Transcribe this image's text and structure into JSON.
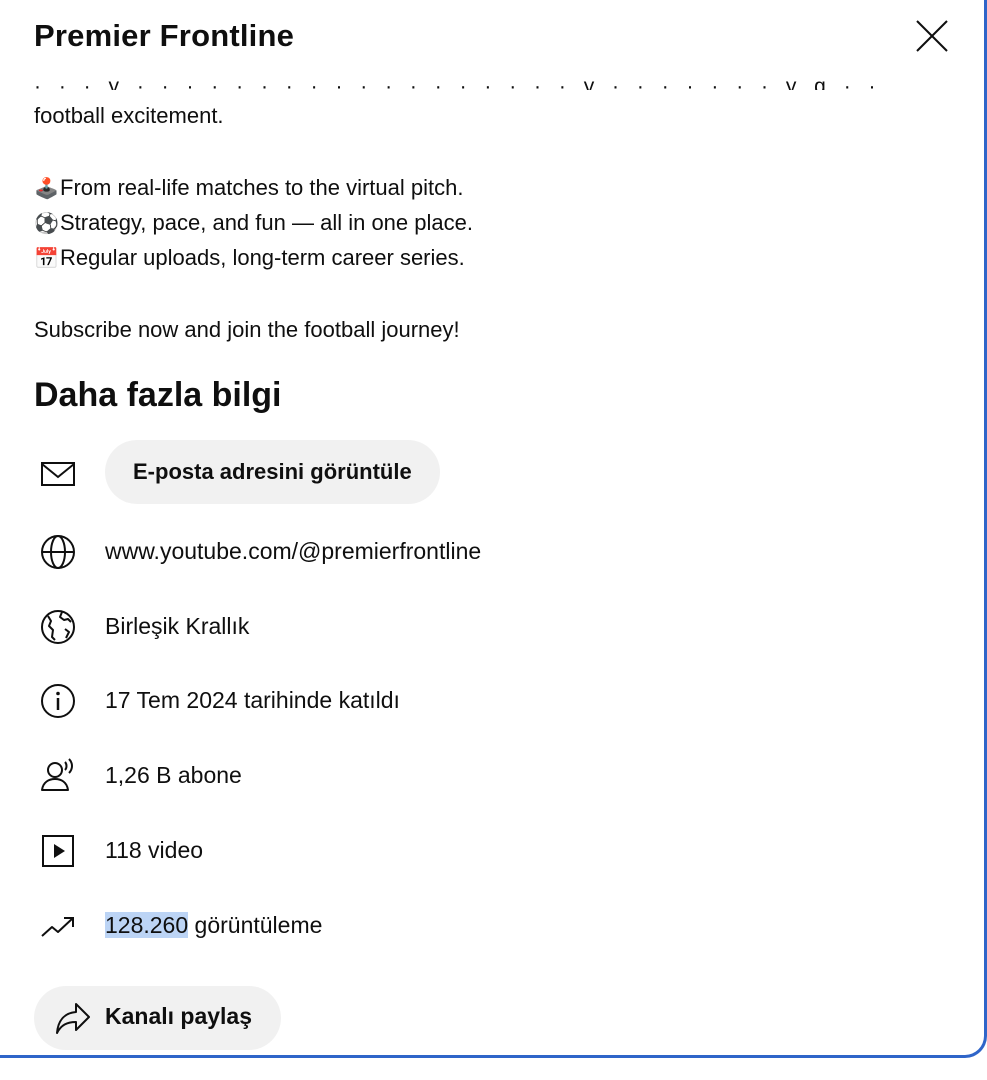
{
  "dialog": {
    "title": "Premier Frontline",
    "close_icon": "close-icon"
  },
  "description": {
    "cutoff_line": "· · · y   ·   · · · ·   · ·   · · · · · · ·   · · · ·   y   ·   · · · · ·   ·   y   g · · ·   ·   · · ·",
    "line_1": "football excitement.",
    "bullets": [
      {
        "emoji": "🕹️",
        "text": "From real-life matches to the virtual pitch."
      },
      {
        "emoji": "⚽",
        "text": "Strategy, pace, and fun — all in one place."
      },
      {
        "emoji": "📅",
        "text": "Regular uploads, long-term career series."
      }
    ],
    "closing": "Subscribe now and join the football journey!"
  },
  "more_info": {
    "title": "Daha fazla bilgi",
    "email_button": "E-posta adresini görüntüle",
    "channel_url": "www.youtube.com/@premierfrontline",
    "country": "Birleşik Krallık",
    "joined": "17 Tem 2024 tarihinde katıldı",
    "subscribers": "1,26 B abone",
    "videos": "118 video",
    "views_number": "128.260",
    "views_suffix": " görüntüleme",
    "share_button": "Kanalı paylaş"
  }
}
